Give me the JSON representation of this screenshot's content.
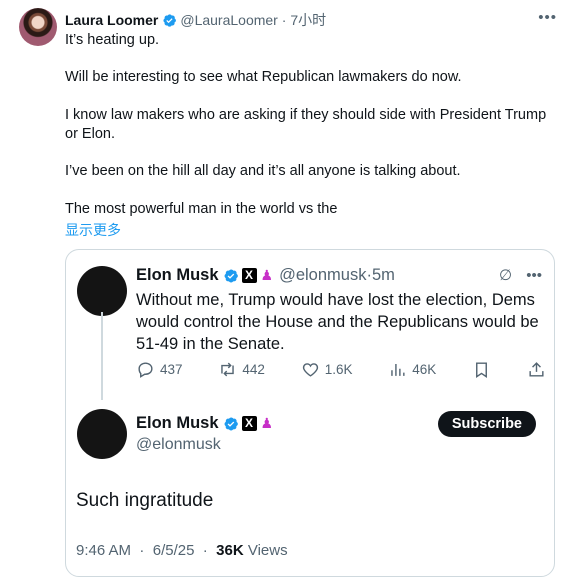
{
  "tweet": {
    "author_name": "Laura Loomer",
    "handle": "@LauraLoomer",
    "time": "7小时",
    "paragraphs": [
      "It’s heating up.",
      "Will be interesting to see what Republican lawmakers do now.",
      "I know law makers who are asking if they should side with President Trump or Elon.",
      "I’ve been on the hill all day and it’s all anyone is talking about.",
      "The most powerful man in the world vs the"
    ],
    "show_more": "显示更多"
  },
  "quoted": {
    "name": "Elon Musk",
    "handle": "@elonmusk",
    "time": "5m",
    "separator": "·",
    "text": "Without me, Trump would have lost the election, Dems would control the House and the Republicans would be 51-49 in the Senate.",
    "stats": {
      "replies": "437",
      "reposts": "442",
      "likes": "1.6K",
      "views": "46K"
    }
  },
  "reply": {
    "name": "Elon Musk",
    "handle": "@elonmusk",
    "subscribe": "Subscribe",
    "text": "Such ingratitude",
    "time": "9:46 AM",
    "date": "6/5/25",
    "views_count": "36K",
    "views_label": "Views"
  },
  "colors": {
    "verified": "#1d9bf0",
    "link": "#1d9bf0",
    "muted": "#536471",
    "badge_purple": "#c72fc7"
  },
  "icons": [
    "verified-icon",
    "x-badge-icon",
    "group-icon",
    "reply-icon",
    "repost-icon",
    "like-icon",
    "views-icon",
    "bookmark-icon",
    "share-icon",
    "more-icon",
    "grok-icon"
  ]
}
